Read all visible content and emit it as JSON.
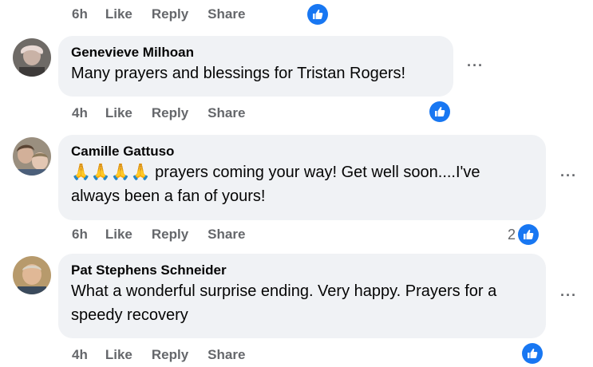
{
  "comments": [
    {
      "actions": {
        "time": "6h",
        "like": "Like",
        "reply": "Reply",
        "share": "Share"
      },
      "reaction_count": ""
    },
    {
      "author": "Genevieve Milhoan",
      "text": "Many prayers and blessings for Tristan Rogers!",
      "more": "···",
      "actions": {
        "time": "4h",
        "like": "Like",
        "reply": "Reply",
        "share": "Share"
      },
      "reaction_count": ""
    },
    {
      "author": "Camille Gattuso",
      "emoji": "🙏🙏🙏🙏",
      "text": " prayers coming your way! Get well soon....I've always been a fan of yours!",
      "more": "···",
      "actions": {
        "time": "6h",
        "like": "Like",
        "reply": "Reply",
        "share": "Share"
      },
      "reaction_count": "2"
    },
    {
      "author": "Pat Stephens Schneider",
      "text": "What a wonderful surprise ending. Very happy. Prayers for a speedy recovery",
      "more": "···",
      "actions": {
        "time": "4h",
        "like": "Like",
        "reply": "Reply",
        "share": "Share"
      },
      "reaction_count": ""
    }
  ],
  "colors": {
    "accent": "#1877f2",
    "bubble": "#f0f2f5",
    "muted": "#65676b"
  },
  "icons": {
    "reaction": "thumbs-up-icon"
  }
}
